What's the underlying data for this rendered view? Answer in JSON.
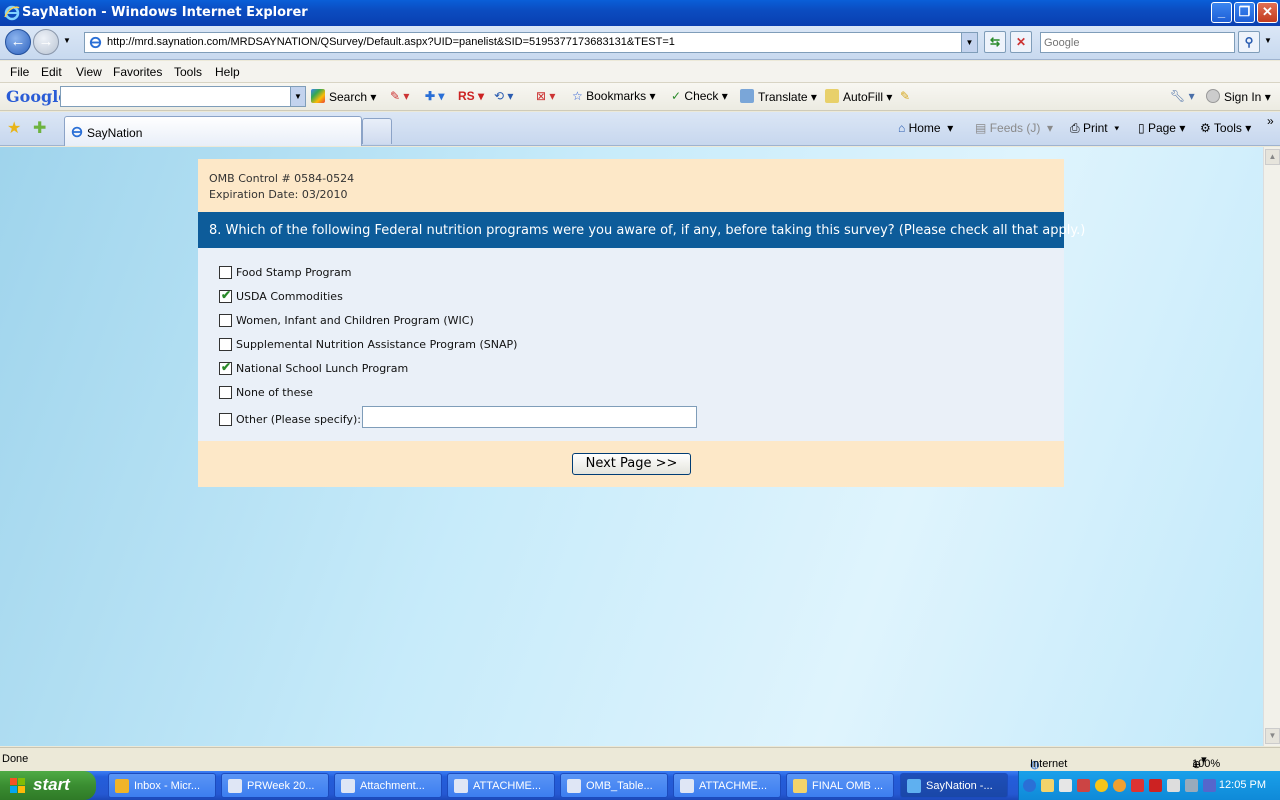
{
  "window": {
    "title": "SayNation - Windows Internet Explorer"
  },
  "address": {
    "url": "http://mrd.saynation.com/MRDSAYNATION/QSurvey/Default.aspx?UID=panelist&SID=5195377173683131&TEST=1",
    "search_placeholder": "Google"
  },
  "menu": [
    "File",
    "Edit",
    "View",
    "Favorites",
    "Tools",
    "Help"
  ],
  "google_toolbar": {
    "logo": "Google",
    "search": "Search",
    "rs": "RS",
    "bookmarks": "Bookmarks",
    "check": "Check",
    "translate": "Translate",
    "autofill": "AutoFill",
    "signin": "Sign In"
  },
  "tabs": {
    "active_label": "SayNation"
  },
  "commands": {
    "home": "Home",
    "feeds": "Feeds (J)",
    "print": "Print",
    "page": "Page",
    "tools": "Tools"
  },
  "survey": {
    "omb_control": "OMB Control # 0584-0524",
    "expiration": "Expiration Date: 03/2010",
    "question": "8.  Which of the following Federal nutrition programs were you aware of, if any, before taking this survey? (Please check all that apply.)",
    "options": [
      {
        "label": "Food Stamp Program",
        "checked": false
      },
      {
        "label": "USDA Commodities",
        "checked": true
      },
      {
        "label": "Women, Infant and Children Program (WIC)",
        "checked": false
      },
      {
        "label": "Supplemental Nutrition Assistance Program (SNAP)",
        "checked": false
      },
      {
        "label": "National School Lunch Program",
        "checked": true
      },
      {
        "label": "None of these",
        "checked": false
      },
      {
        "label": "Other (Please specify):",
        "checked": false
      }
    ],
    "other_value": "",
    "next_button": "Next Page >>"
  },
  "status": {
    "left": "Done",
    "zone": "Internet",
    "zoom": "100%"
  },
  "taskbar": {
    "start": "start",
    "items": [
      "Inbox - Micr...",
      "PRWeek 20...",
      "Attachment...",
      "ATTACHME...",
      "OMB_Table...",
      "ATTACHME...",
      "FINAL OMB ...",
      "SayNation -..."
    ],
    "clock": "12:05 PM"
  },
  "colors": {
    "question_bar": "#0d5c9a",
    "survey_bg": "#fde8c8",
    "options_bg": "#eaf0f8"
  }
}
